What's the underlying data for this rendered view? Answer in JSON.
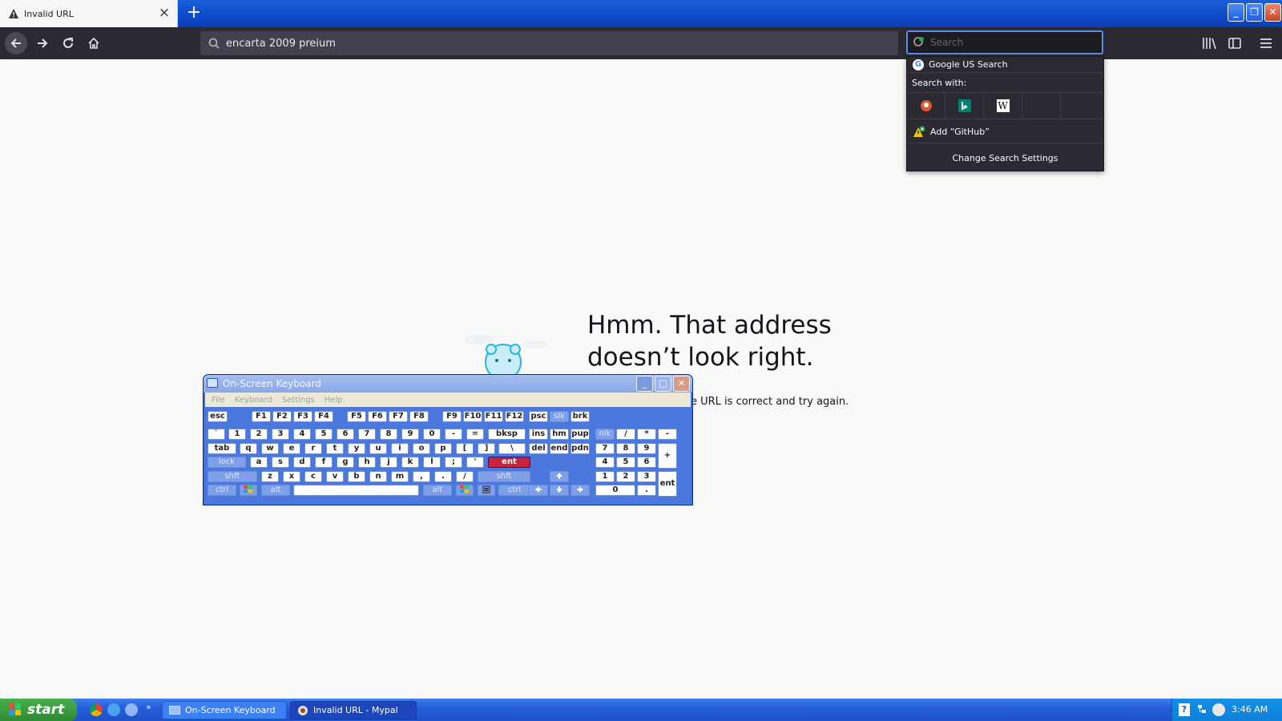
{
  "browser": {
    "tab": {
      "title": "Invalid URL"
    },
    "urlbar": {
      "value": "encarta 2009 preium"
    },
    "searchbar": {
      "placeholder": "Search"
    }
  },
  "search_popup": {
    "default_engine": "Google US Search",
    "search_with_label": "Search with:",
    "engines": [
      "duckduckgo-icon",
      "bing-icon",
      "wikipedia-icon"
    ],
    "wikipedia_glyph": "W",
    "add_engine": "Add “GitHub”",
    "change_settings": "Change Search Settings"
  },
  "page": {
    "error_title": "Hmm. That address doesn’t look right.",
    "error_text": "e URL is correct and try again."
  },
  "osk": {
    "title": "On-Screen Keyboard",
    "menu": [
      "File",
      "Keyboard",
      "Settings",
      "Help"
    ],
    "keys": {
      "esc": "esc",
      "f1": "F1",
      "f2": "F2",
      "f3": "F3",
      "f4": "F4",
      "f5": "F5",
      "f6": "F6",
      "f7": "F7",
      "f8": "F8",
      "f9": "F9",
      "f10": "F10",
      "f11": "F11",
      "f12": "F12",
      "psc": "psc",
      "slk": "slk",
      "brk": "brk",
      "backtick": "`",
      "n1": "1",
      "n2": "2",
      "n3": "3",
      "n4": "4",
      "n5": "5",
      "n6": "6",
      "n7": "7",
      "n8": "8",
      "n9": "9",
      "n0": "0",
      "minus": "-",
      "equals": "=",
      "bksp": "bksp",
      "ins": "ins",
      "hm": "hm",
      "pup": "pup",
      "nlk": "nlk",
      "np_div": "/",
      "np_mul": "*",
      "np_minus": "-",
      "tab": "tab",
      "q": "q",
      "w": "w",
      "e": "e",
      "r": "r",
      "t": "t",
      "y": "y",
      "u": "u",
      "i": "i",
      "o": "o",
      "p": "p",
      "lbracket": "[",
      "rbracket": "]",
      "backslash": "\\",
      "del": "del",
      "end": "end",
      "pdn": "pdn",
      "np7": "7",
      "np8": "8",
      "np9": "9",
      "np_plus": "+",
      "lock": "lock",
      "a": "a",
      "s": "s",
      "d": "d",
      "f": "f",
      "g": "g",
      "h": "h",
      "j": "j",
      "k": "k",
      "l": "l",
      "semicolon": ";",
      "quote": "'",
      "ent": "ent",
      "np4": "4",
      "np5": "5",
      "np6": "6",
      "lshft": "shft",
      "z": "z",
      "x": "x",
      "c": "c",
      "v": "v",
      "b": "b",
      "n": "n",
      "m": "m",
      "comma": ",",
      "period": ".",
      "slash": "/",
      "rshft": "shft",
      "np1": "1",
      "np2": "2",
      "np3": "3",
      "np_ent": "ent",
      "lctrl": "ctrl",
      "lalt": "alt",
      "ralt": "alt",
      "rctrl": "ctrl",
      "np0": "0",
      "np_dot": "."
    }
  },
  "taskbar": {
    "start": "start",
    "more": "»",
    "tasks": [
      {
        "label": "On-Screen Keyboard"
      },
      {
        "label": "Invalid URL - Mypal"
      }
    ],
    "help_glyph": "?",
    "clock": "3:46 AM"
  }
}
